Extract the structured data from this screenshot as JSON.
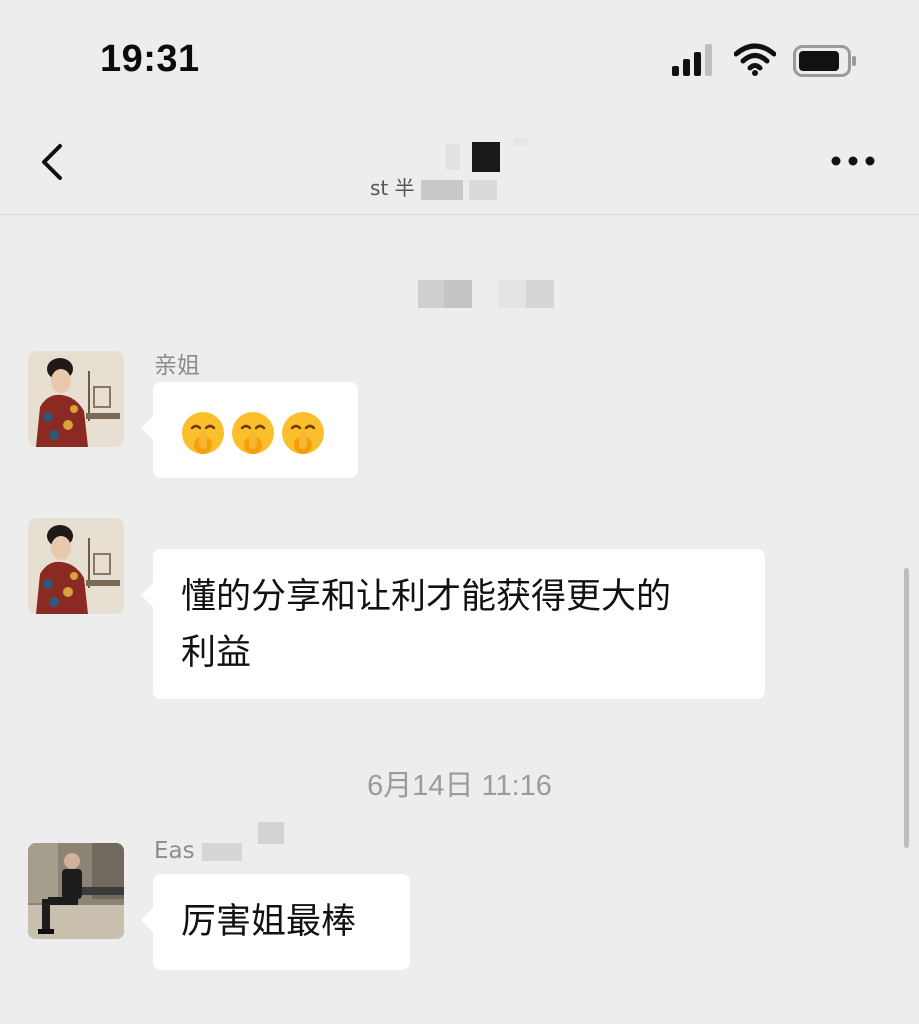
{
  "status_bar": {
    "time": "19:31"
  },
  "nav": {
    "subtitle": "st 半",
    "icons": {
      "back": "chevron-left-icon",
      "more": "more-dots-icon"
    }
  },
  "messages": [
    {
      "sender": "亲姐",
      "text": "",
      "emojis": [
        "shushing-face-emoji",
        "shushing-face-emoji",
        "shushing-face-emoji"
      ]
    },
    {
      "sender": "",
      "text_line1": "懂的分享和让利才能获得更大的",
      "text_line2": "利益"
    },
    {
      "sender": "Eas",
      "text": "厉害姐最棒"
    }
  ],
  "time_separator": "6月14日 11:16",
  "colors": {
    "background": "#ededed",
    "bubble": "#ffffff",
    "timestamp": "#9b9b9b"
  }
}
